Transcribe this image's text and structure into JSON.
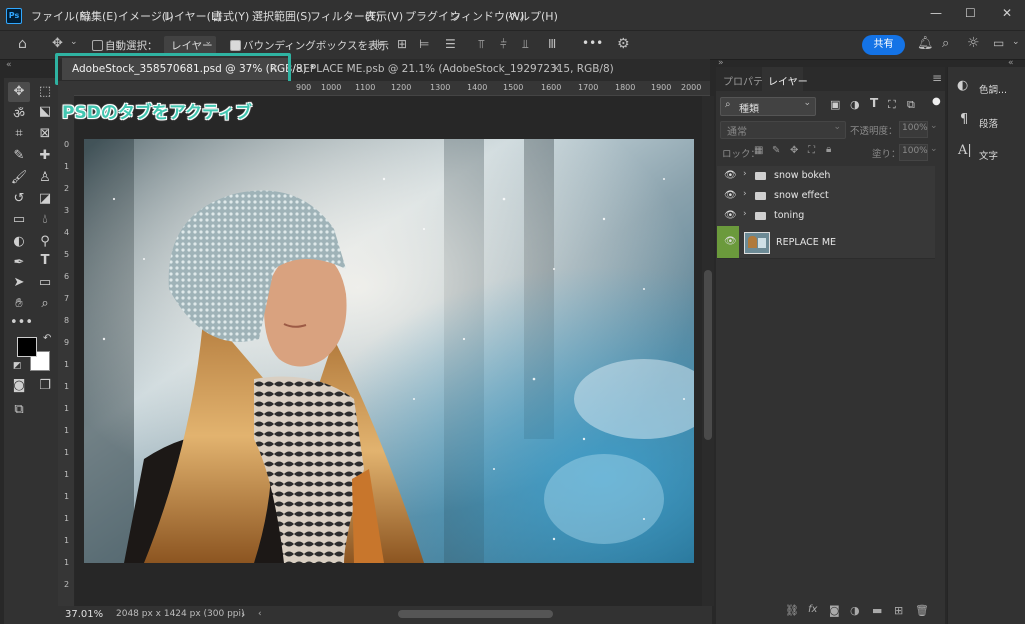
{
  "app": {
    "logo": "Ps"
  },
  "menu": [
    "ファイル(F)",
    "編集(E)",
    "イメージ(I)",
    "レイヤー(L)",
    "書式(Y)",
    "選択範囲(S)",
    "フィルター(T)",
    "表示(V)",
    "プラグイン",
    "ウィンドウ(W)",
    "ヘルプ(H)"
  ],
  "window_controls": {
    "minimize": "—",
    "maximize": "☐",
    "close": "✕"
  },
  "options": {
    "auto_select_label": "自動選択：",
    "auto_select_value": "レイヤー",
    "bounding_box_label": "バウンディングボックスを表示",
    "more": "•••",
    "share": "共有"
  },
  "tabs": [
    {
      "label": "AdobeStock_358570681.psd @ 37% (RGB/8) *",
      "close": "×",
      "active": true
    },
    {
      "label": "REPLACE ME.psb @ 21.1% (AdobeStock_192972315, RGB/8)",
      "close": "×",
      "active": false
    }
  ],
  "annotation": "PSDのタブをアクティブ",
  "ruler": {
    "top": [
      "900",
      "1000",
      "1100",
      "1200",
      "1300",
      "1400",
      "1500",
      "1600",
      "1700",
      "1800",
      "1900",
      "2000"
    ],
    "left": [
      "0",
      "1",
      "2",
      "3",
      "4",
      "5",
      "6",
      "7",
      "8",
      "9",
      "1",
      "1",
      "1",
      "1",
      "1",
      "1",
      "1",
      "1",
      "1",
      "1",
      "2"
    ]
  },
  "status": {
    "zoom": "37.01%",
    "doc_info": "2048 px x 1424 px (300 ppi)",
    "arrow": "›"
  },
  "layers_panel": {
    "tab_properties": "プロパティ",
    "tab_layers": "レイヤー",
    "filter_kind": "種類",
    "blend_mode": "通常",
    "opacity_label": "不透明度：",
    "opacity_value": "100%",
    "lock_label": "ロック：",
    "fill_label": "塗り：",
    "fill_value": "100%",
    "layers": [
      {
        "name": "snow bokeh",
        "type": "group"
      },
      {
        "name": "snow effect",
        "type": "group"
      },
      {
        "name": "toning",
        "type": "group"
      },
      {
        "name": "REPLACE ME",
        "type": "smart-object"
      }
    ]
  },
  "side_panel": {
    "items": [
      {
        "label": "色調...",
        "icon": "adjustments-icon"
      },
      {
        "label": "段落",
        "icon": "paragraph-icon"
      },
      {
        "label": "文字",
        "icon": "character-icon"
      }
    ]
  },
  "colors": {
    "accent": "#2fb3a2",
    "share": "#1473e6",
    "eye_active_bg": "#6b9a3c"
  }
}
